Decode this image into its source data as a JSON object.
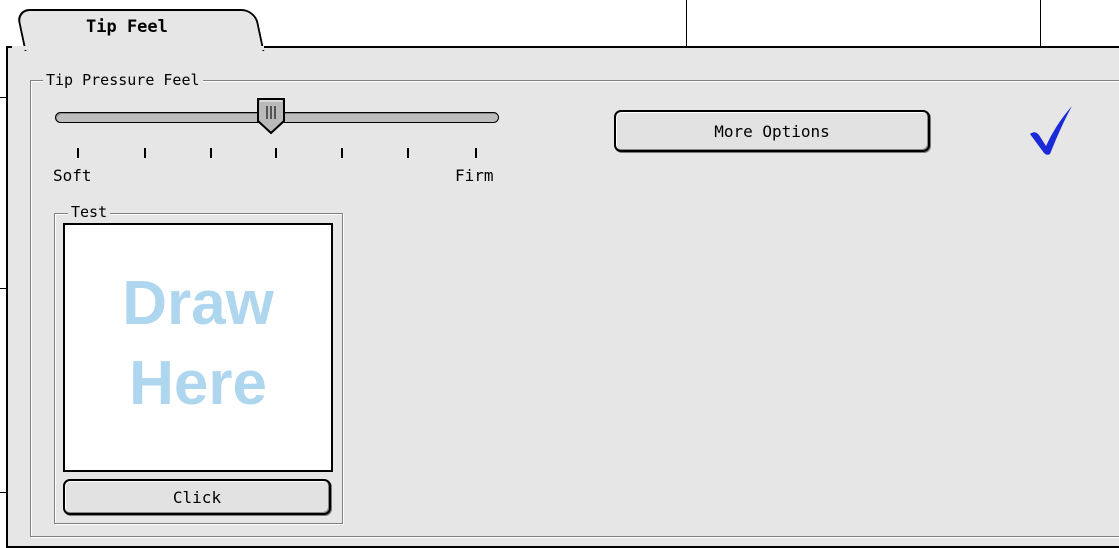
{
  "tab": {
    "label": "Tip Feel"
  },
  "pressure_group": {
    "title": "Tip Pressure Feel"
  },
  "slider": {
    "min_label": "Soft",
    "max_label": "Firm",
    "tick_count": 7,
    "selected_tick": 4
  },
  "more_options_button": {
    "label": "More Options"
  },
  "test_group": {
    "title": "Test"
  },
  "draw_area": {
    "line1": "Draw",
    "line2": "Here"
  },
  "click_button": {
    "label": "Click"
  },
  "status": {
    "icon": "checkmark-icon",
    "color": "#1a2ad8"
  }
}
